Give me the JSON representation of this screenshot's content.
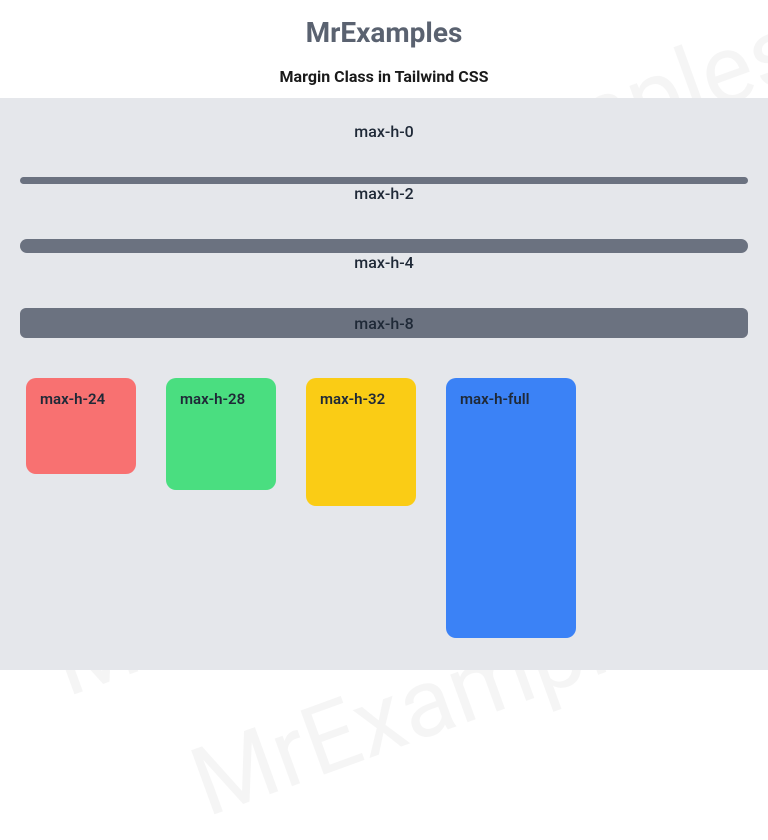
{
  "watermark": "MrExamples",
  "header": {
    "title": "MrExamples",
    "subtitle": "Margin Class in Tailwind CSS"
  },
  "bars": [
    {
      "label": "max-h-0",
      "cls": "bar-0"
    },
    {
      "label": "max-h-2",
      "cls": "bar-2"
    },
    {
      "label": "max-h-4",
      "cls": "bar-4"
    },
    {
      "label": "max-h-8",
      "cls": "bar-8"
    }
  ],
  "boxes": [
    {
      "label": "max-h-24",
      "color": "box-red"
    },
    {
      "label": "max-h-28",
      "color": "box-green"
    },
    {
      "label": "max-h-32",
      "color": "box-yellow"
    },
    {
      "label": "max-h-full",
      "color": "box-blue",
      "extra": "box-last"
    }
  ]
}
